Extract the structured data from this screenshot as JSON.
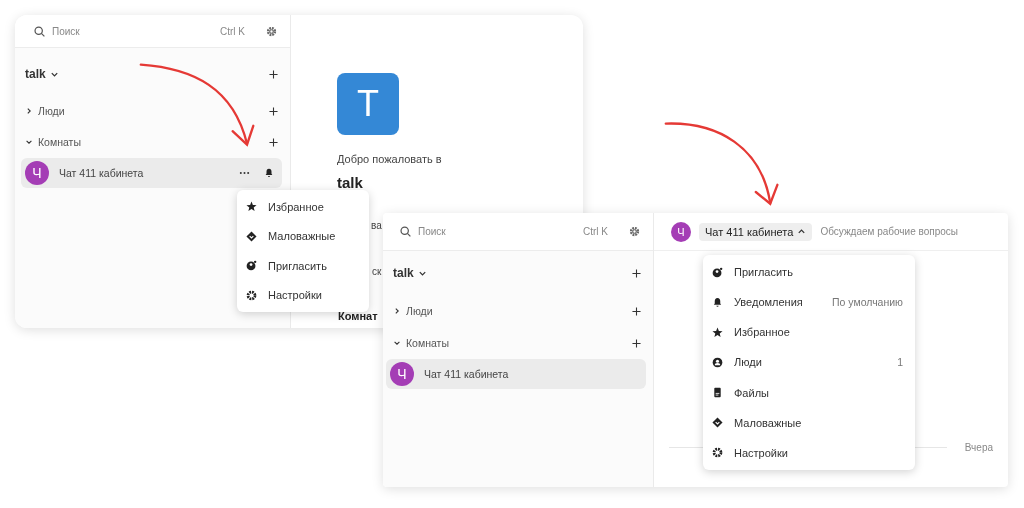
{
  "windows": [
    {
      "search": {
        "placeholder": "Поиск",
        "shortcut": "Ctrl K"
      },
      "workspace": "talk",
      "sections": [
        {
          "label": "Люди",
          "expanded": false
        },
        {
          "label": "Комнаты",
          "expanded": true,
          "rooms": [
            {
              "avatar": "Ч",
              "name": "Чат 411 кабинета",
              "selected": true,
              "hovered": true
            }
          ]
        }
      ],
      "main": {
        "avatar": "T",
        "welcome": "Добро пожаловать в",
        "title": "talk",
        "fragments": [
          "ва",
          "ск",
          "Комнат"
        ]
      },
      "menu": [
        {
          "kind": "favorite",
          "label": "Избранное"
        },
        {
          "kind": "low",
          "label": "Маловажные"
        },
        {
          "kind": "invite",
          "label": "Пригласить"
        },
        {
          "kind": "settings",
          "label": "Настройки"
        }
      ]
    },
    {
      "search": {
        "placeholder": "Поиск",
        "shortcut": "Ctrl K"
      },
      "workspace": "talk",
      "sections": [
        {
          "label": "Люди",
          "expanded": false
        },
        {
          "label": "Комнаты",
          "expanded": true,
          "rooms": [
            {
              "avatar": "Ч",
              "name": "Чат 411 кабинета",
              "selected": true,
              "hovered": false
            }
          ]
        }
      ],
      "header": {
        "avatar": "Ч",
        "room": "Чат 411 кабинета",
        "expanded": true,
        "topic": "Обсуждаем рабочие вопросы"
      },
      "divider_label": "Вчера",
      "menu": [
        {
          "kind": "invite",
          "label": "Пригласить"
        },
        {
          "kind": "notifications",
          "label": "Уведомления",
          "value": "По умолчанию"
        },
        {
          "kind": "favorite",
          "label": "Избранное"
        },
        {
          "kind": "people",
          "label": "Люди",
          "value": "1"
        },
        {
          "kind": "files",
          "label": "Файлы"
        },
        {
          "kind": "low",
          "label": "Маловажные"
        },
        {
          "kind": "settings",
          "label": "Настройки"
        }
      ]
    }
  ]
}
